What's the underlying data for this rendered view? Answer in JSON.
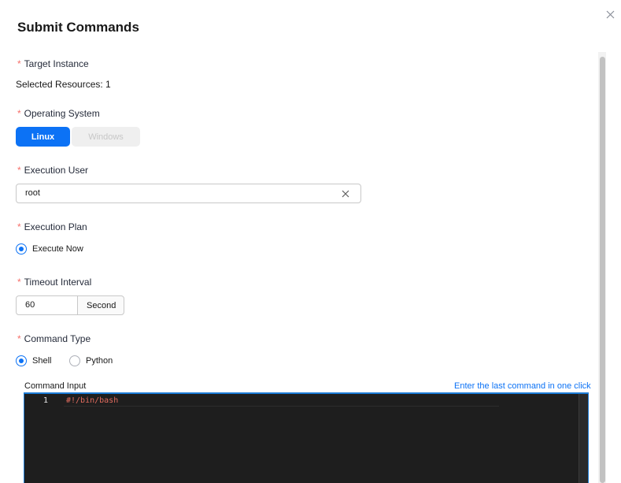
{
  "dialog": {
    "title": "Submit Commands"
  },
  "form": {
    "required_mark": "*",
    "target_instance": {
      "label": "Target Instance",
      "value": "Selected Resources: 1"
    },
    "operating_system": {
      "label": "Operating System",
      "options": [
        "Linux",
        "Windows"
      ],
      "selected": "Linux"
    },
    "execution_user": {
      "label": "Execution User",
      "value": "root"
    },
    "execution_plan": {
      "label": "Execution Plan",
      "option": "Execute Now"
    },
    "timeout_interval": {
      "label": "Timeout Interval",
      "value": "60",
      "unit": "Second"
    },
    "command_type": {
      "label": "Command Type",
      "options": [
        "Shell",
        "Python"
      ],
      "selected": "Shell"
    },
    "command_input": {
      "label": "Command Input",
      "link": "Enter the last command in one click",
      "line_number": "1",
      "code": "#!/bin/bash"
    }
  },
  "colors": {
    "accent": "#0c72f5",
    "required": "#f66f6a",
    "editor_bg": "#1e1e1e",
    "code_text": "#e26c5e"
  },
  "icons": {
    "close": "close-icon",
    "clear": "clear-icon"
  }
}
